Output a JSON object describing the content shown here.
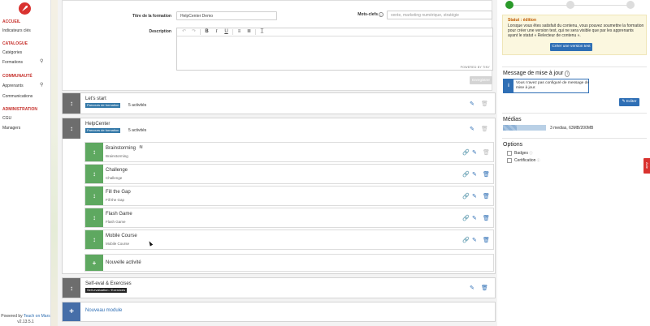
{
  "sidebar": {
    "sections": [
      {
        "heading": "ACCUEIL",
        "items": [
          {
            "label": "Indicateurs clés"
          }
        ]
      },
      {
        "heading": "CATALOGUE",
        "items": [
          {
            "label": "Catégories"
          },
          {
            "label": "Formations",
            "icon": "search-icon"
          }
        ]
      },
      {
        "heading": "COMMUNAUTÉ",
        "items": [
          {
            "label": "Apprenants",
            "icon": "search-icon"
          },
          {
            "label": "Communications"
          }
        ]
      },
      {
        "heading": "ADMINISTRATION",
        "items": [
          {
            "label": "CGU"
          },
          {
            "label": "Managers"
          }
        ]
      }
    ],
    "footer": {
      "powered": "Powered by",
      "brand": "Teach on Mars",
      "version": "v2.13.5.1"
    }
  },
  "form": {
    "title_label": "Titre de la formation",
    "title_value": "HelpCenter Demo",
    "keywords_label": "Mots-clefs",
    "keywords_placeholder": "vente, marketing numérique, stratégie",
    "description_label": "Description",
    "powered_by": "POWERED BY TINY",
    "save_label": "Enregistrer"
  },
  "modules": [
    {
      "title": "Let's start",
      "tag": "Parcours de formation",
      "count": "5 activités"
    },
    {
      "title": "HelpCenter",
      "tag": "Parcours de formation",
      "count": "5 activités",
      "activities": [
        {
          "title": "Brainstorming",
          "subtitle": "Brainstorming",
          "icon": "wifi-icon"
        },
        {
          "title": "Challenge",
          "subtitle": "Challenge"
        },
        {
          "title": "Fill the Gap",
          "subtitle": "Fill the Gap"
        },
        {
          "title": "Flash Game",
          "subtitle": "Flash Game"
        },
        {
          "title": "Mobile Course",
          "subtitle": "Mobile Course"
        }
      ],
      "new_activity": "Nouvelle activité"
    },
    {
      "title": "Self-eval & Exercises",
      "tag": "Self-evaluation / Exercices"
    }
  ],
  "new_module": "Nouveau module",
  "right": {
    "status_title": "Statut : édition",
    "status_text": "Lorsque vous êtes satisfait du contenu, vous pouvez soumettre la formation pour créer une version test, qui ne sera visible que par les apprenants ayant le statut « Relecteur de contenu ».",
    "create_test_label": "Créer une version test",
    "update_title": "Message de mise à jour",
    "update_notice": "Vous n'avez pas configuré de message de mise à jour.",
    "edit_label": "Editer",
    "media_title": "Médias",
    "media_text": "3 medias, 63MB/200MB",
    "media_fraction": 0.315,
    "options_title": "Options",
    "options": [
      {
        "label": "Badges"
      },
      {
        "label": "Certification"
      }
    ],
    "help_tab": "Aide"
  },
  "colors": {
    "accent": "#2f6fb5",
    "brand": "#d9322f",
    "module_grip": "#6d6d6d",
    "activity_grip": "#5ea860",
    "step_done": "#2a9a2a"
  }
}
